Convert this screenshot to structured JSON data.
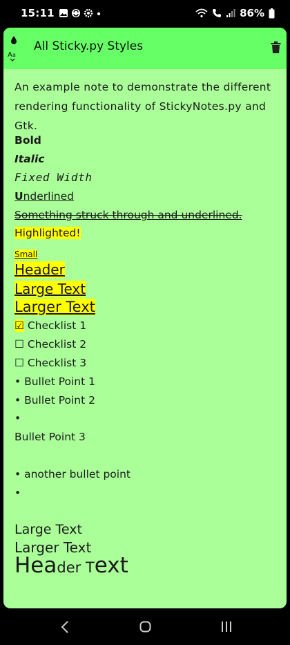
{
  "status_bar": {
    "time": "15:11",
    "left_icons": [
      "image-icon",
      "sync-icon",
      "settings-gear-icon",
      "dot-icon"
    ],
    "right_icons": [
      "wifi-icon",
      "call-icon",
      "signal-icon"
    ],
    "battery": "86%"
  },
  "app": {
    "title": "All Sticky.py Styles",
    "icons": [
      "drop-icon",
      "font-size-icon",
      "trash-icon"
    ],
    "colors": {
      "header": "#66ff66",
      "body": "#aaff99",
      "highlight": "#ffff00"
    }
  },
  "note": {
    "intro": "An example note to demonstrate the different rendering functionality of StickyNotes.py and Gtk.",
    "bold": "Bold",
    "italic": "Italic",
    "fixed_width": "Fixed Width",
    "underlined_first": "U",
    "underlined_rest": "nderlined",
    "strikethrough": "Something struck through and underlined.",
    "highlighted": "Highlighted!",
    "small": "Small",
    "header": "Header",
    "large_text": "Large Text",
    "larger_text": "Larger Text",
    "checklist": [
      {
        "checkbox": "☑",
        "label": "Checklist 1",
        "checked": true
      },
      {
        "checkbox": "☐",
        "label": "Checklist 2",
        "checked": false
      },
      {
        "checkbox": "☐",
        "label": "Checklist 3",
        "checked": false
      }
    ],
    "bullets": [
      {
        "bullet": "•",
        "label": "Bullet Point 1"
      },
      {
        "bullet": "•",
        "label": "Bullet Point 2"
      },
      {
        "bullet": "•",
        "label": ""
      }
    ],
    "bullet_point_3": "Bullet Point 3",
    "another_bullet": {
      "bullet": "•",
      "label": "another bullet point"
    },
    "empty_bullet": "•",
    "plain_large": "Large Text",
    "plain_larger": "Larger Text",
    "mixed_heading": [
      "Hea",
      "der T",
      "ext"
    ]
  },
  "nav": {
    "icons": [
      "back-icon",
      "home-icon",
      "recents-icon"
    ]
  }
}
